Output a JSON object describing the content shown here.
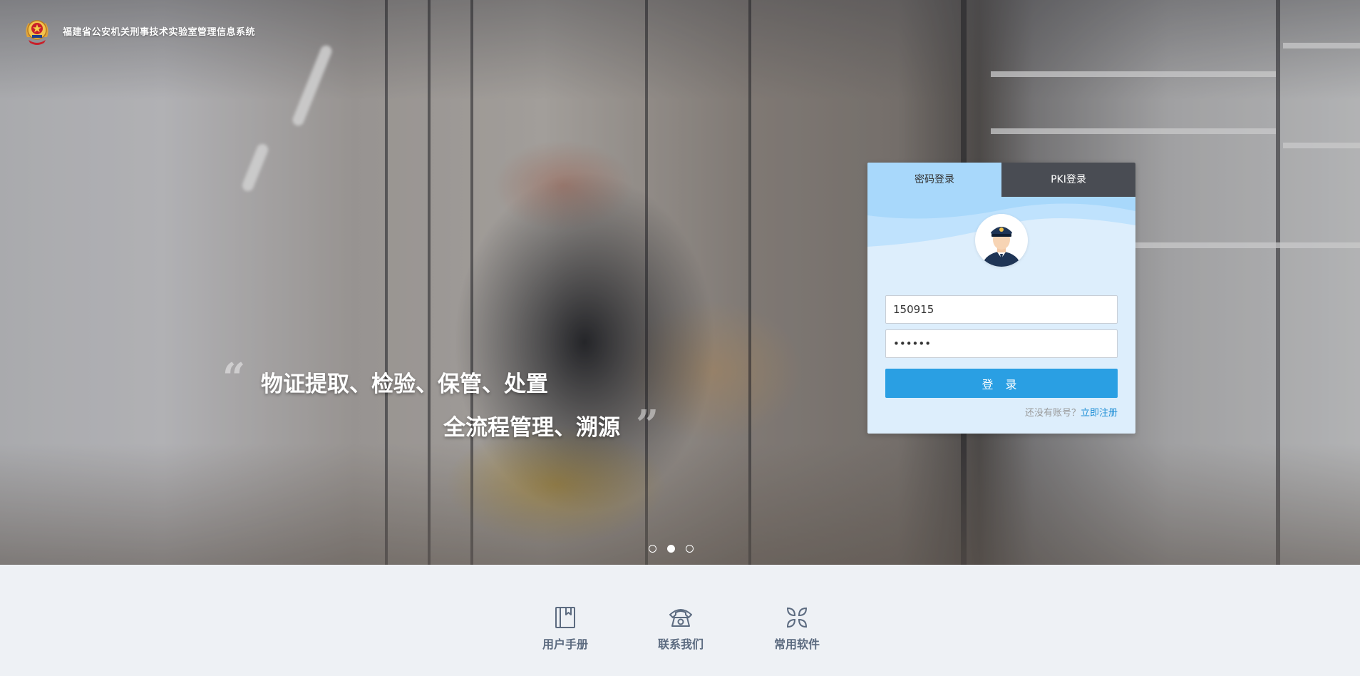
{
  "header": {
    "app_title": "福建省公安机关刑事技术实验室管理信息系统",
    "logo_icon": "police-emblem-icon"
  },
  "hero": {
    "slogan_line1": "物证提取、检验、保管、处置",
    "slogan_line2": "全流程管理、溯源",
    "open_quote": "“",
    "close_quote": "”",
    "carousel": {
      "slide_count": 3,
      "active_index": 1
    }
  },
  "login": {
    "tabs": [
      {
        "label": "密码登录",
        "active": true
      },
      {
        "label": "PKI登录",
        "active": false
      }
    ],
    "avatar_icon": "police-officer-avatar-icon",
    "username_value": "150915",
    "password_value": "••••••",
    "submit_label": "登 录",
    "register_prompt": "还没有账号？",
    "register_link": "立即注册",
    "colors": {
      "accent": "#2a9fe3",
      "panel_bg": "#ddeefc",
      "active_tab": "#a8d8fb"
    }
  },
  "footer": {
    "items": [
      {
        "label": "用户手册",
        "icon": "book-icon"
      },
      {
        "label": "联系我们",
        "icon": "telephone-icon"
      },
      {
        "label": "常用软件",
        "icon": "apps-grid-icon"
      }
    ],
    "colors": {
      "icon": "#5c6b80",
      "bg": "#eef1f5"
    }
  }
}
